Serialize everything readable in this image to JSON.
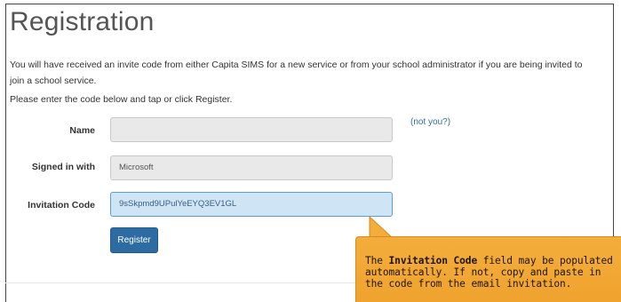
{
  "page": {
    "title": "Registration",
    "intro_text": "You will have received an invite code from either Capita SIMS for a new service or from your school administrator if you are being invited to join a school service.",
    "instruction_text": "Please enter the code below and tap or click Register."
  },
  "form": {
    "name": {
      "label": "Name",
      "value": ""
    },
    "signed_in_with": {
      "label": "Signed in with",
      "value": "Microsoft"
    },
    "invitation_code": {
      "label": "Invitation Code",
      "value": "9sSkpmd9UPulYeEYQ3EV1GL"
    },
    "not_you_link": "(not you?)",
    "register_button": "Register"
  },
  "callout": {
    "prefix": "The ",
    "highlight": "Invitation Code",
    "suffix": " field may be populated automatically. If not, copy and paste in the code from the email invitation."
  },
  "colors": {
    "primary_button": "#2d6ca2",
    "link": "#2e6da4",
    "callout_bg": "#f0a22d",
    "active_field_bg": "#cfe5f5"
  }
}
